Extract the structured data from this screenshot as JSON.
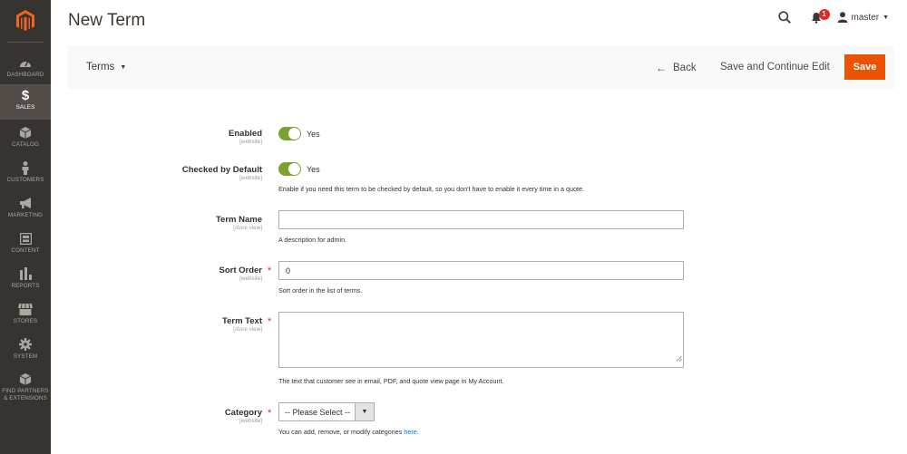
{
  "sidebar": {
    "logo_icon": "magento-logo-icon",
    "items": [
      {
        "label": "DASHBOARD",
        "icon": "speedometer-icon",
        "active": false
      },
      {
        "label": "SALES",
        "icon": "dollar-icon",
        "active": true
      },
      {
        "label": "CATALOG",
        "icon": "cube-icon",
        "active": false
      },
      {
        "label": "CUSTOMERS",
        "icon": "person-icon",
        "active": false
      },
      {
        "label": "MARKETING",
        "icon": "megaphone-icon",
        "active": false
      },
      {
        "label": "CONTENT",
        "icon": "layout-icon",
        "active": false
      },
      {
        "label": "REPORTS",
        "icon": "bar-chart-icon",
        "active": false
      },
      {
        "label": "STORES",
        "icon": "storefront-icon",
        "active": false
      },
      {
        "label": "SYSTEM",
        "icon": "gear-icon",
        "active": false
      },
      {
        "label": "FIND PARTNERS & EXTENSIONS",
        "icon": "cube-icon",
        "active": false
      }
    ]
  },
  "header": {
    "title": "New Term",
    "notification_count": "1",
    "user_name": "master"
  },
  "action_bar": {
    "scope_label": "Terms",
    "back_label": "Back",
    "save_continue_label": "Save and Continue Edit",
    "save_label": "Save"
  },
  "form": {
    "enabled": {
      "label": "Enabled",
      "scope": "[website]",
      "value_text": "Yes",
      "on": true
    },
    "checked_default": {
      "label": "Checked by Default",
      "scope": "[website]",
      "value_text": "Yes",
      "on": true,
      "note": "Enable if you need this term to be checked by default, so you don't have to enable it every time in a quote."
    },
    "term_name": {
      "label": "Term Name",
      "scope": "[store view]",
      "value": "",
      "note": "A description for admin."
    },
    "sort_order": {
      "label": "Sort Order",
      "scope": "[website]",
      "value": "0",
      "note": "Sort order in the list of terms.",
      "required": true
    },
    "term_text": {
      "label": "Term Text",
      "scope": "[store view]",
      "value": "",
      "note": "The text that customer see in email, PDF, and quote view page in My Account.",
      "required": true
    },
    "category": {
      "label": "Category",
      "scope": "[website]",
      "selected": "-- Please Select --",
      "note_prefix": "You can add, remove, or modify categories ",
      "note_link": "here",
      "note_suffix": ".",
      "required": true
    }
  },
  "colors": {
    "sidebar_bg": "#373330",
    "sidebar_active": "#524d49",
    "accent": "#eb5202",
    "toggle_on": "#79a22e",
    "required": "#e22626",
    "link": "#007bdb"
  }
}
